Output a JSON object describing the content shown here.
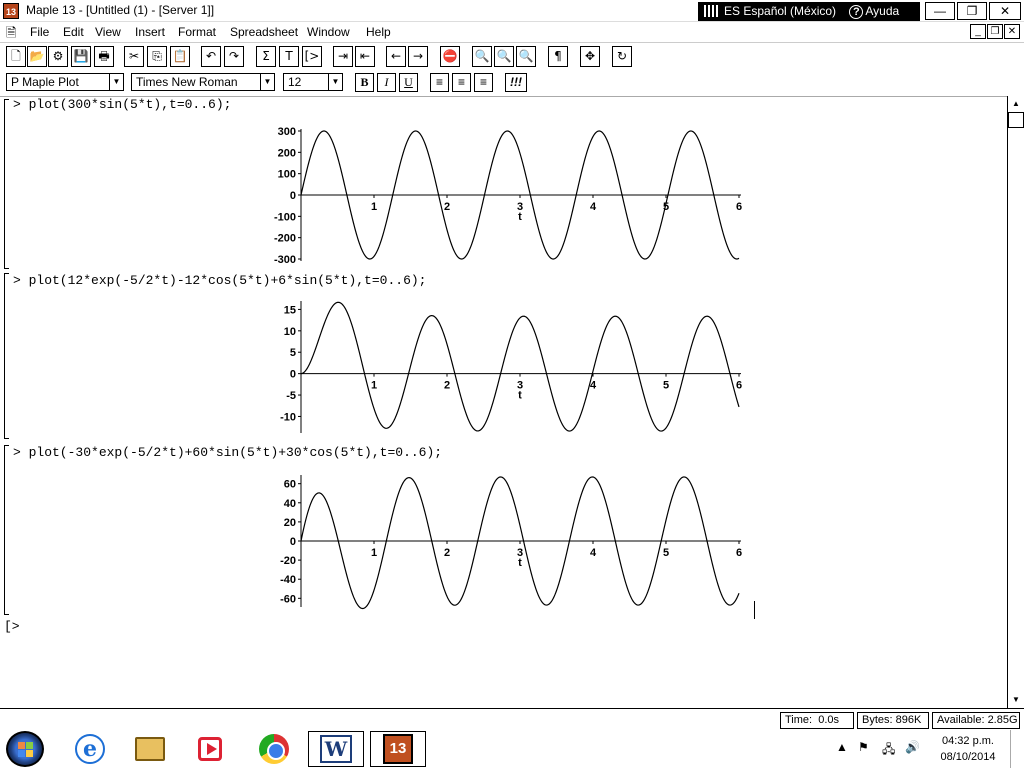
{
  "window": {
    "title": "Maple 13 - [Untitled (1) - [Server 1]]",
    "app_icon_text": "13",
    "language": "ES Español (México)",
    "help": "Ayuda",
    "help_symbol": "?",
    "minimize": "—",
    "maximize": "❐",
    "close": "✕"
  },
  "menu": {
    "items": [
      "File",
      "Edit",
      "View",
      "Insert",
      "Format",
      "Spreadsheet",
      "Window",
      "Help"
    ]
  },
  "toolbar": {
    "buttons": [
      "🗋",
      "📂",
      "⚙",
      "💾",
      "🖶",
      "✂",
      "⎘",
      "📋",
      "↶",
      "↷",
      "Σ",
      "T",
      "[>",
      "⇥",
      "⇤",
      "←",
      "→",
      "⛔",
      "🔍",
      "🔍",
      "🔍",
      "¶",
      "✥",
      "↻"
    ]
  },
  "format_bar": {
    "style_value": "P Maple Plot",
    "font_value": "Times New Roman",
    "size_value": "12",
    "bold": "B",
    "italic": "I",
    "underline": "U",
    "align_left": "≡",
    "align_center": "≡",
    "align_right": "≡",
    "excl": "!!!"
  },
  "worksheet": {
    "commands": [
      "> plot(300*sin(5*t),t=0..6);",
      "> plot(12*exp(-5/2*t)-12*cos(5*t)+6*sin(5*t),t=0..6);",
      "> plot(-30*exp(-5/2*t)+60*sin(5*t)+30*cos(5*t),t=0..6);",
      "[>"
    ]
  },
  "chart_data": [
    {
      "type": "line",
      "expression": "300*sin(5*t)",
      "xlabel": "t",
      "xlim": [
        0,
        6
      ],
      "ylim": [
        -300,
        300
      ],
      "xticks": [
        1,
        2,
        3,
        4,
        5,
        6
      ],
      "yticks": [
        300,
        200,
        100,
        0,
        -100,
        -200,
        -300
      ],
      "yticklabels": [
        "300",
        "200",
        "100",
        "0",
        "-100",
        "-200",
        "-300"
      ],
      "t": [
        0,
        0.314,
        0.628,
        0.942,
        1.257,
        1.571,
        1.885,
        2.199,
        2.513,
        2.827,
        3.142,
        3.456,
        3.77,
        4.084,
        4.398,
        4.712,
        5.027,
        5.341,
        5.655,
        6
      ],
      "y": [
        0,
        300,
        0,
        -300,
        0,
        300,
        0,
        -300,
        0,
        300,
        0,
        -300,
        0,
        300,
        0,
        -300,
        0,
        300,
        0,
        -300
      ]
    },
    {
      "type": "line",
      "expression": "12*exp(-5/2*t)-12*cos(5*t)+6*sin(5*t)",
      "xlabel": "t",
      "xlim": [
        0,
        6
      ],
      "ylim": [
        -13.4,
        16.5
      ],
      "xticks": [
        1,
        2,
        3,
        4,
        5,
        6
      ],
      "yticks": [
        15,
        10,
        5,
        0,
        -5,
        -10
      ],
      "yticklabels": [
        "15",
        "10",
        "5",
        "0",
        "-5",
        "-10"
      ],
      "peaks": [
        {
          "t": 0.48,
          "y": 16.3
        },
        {
          "t": 1.79,
          "y": 13.4
        },
        {
          "t": 3.05,
          "y": 13.4
        },
        {
          "t": 4.31,
          "y": 13.4
        },
        {
          "t": 5.56,
          "y": 13.4
        }
      ],
      "troughs": [
        {
          "t": 1.17,
          "y": -12.6
        },
        {
          "t": 2.42,
          "y": -13.4
        },
        {
          "t": 3.68,
          "y": -13.4
        },
        {
          "t": 4.93,
          "y": -13.4
        }
      ]
    },
    {
      "type": "line",
      "expression": "-30*exp(-5/2*t)+60*sin(5*t)+30*cos(5*t)",
      "xlabel": "t",
      "xlim": [
        0,
        6
      ],
      "ylim": [
        -67,
        67
      ],
      "xticks": [
        1,
        2,
        3,
        4,
        5,
        6
      ],
      "yticks": [
        60,
        40,
        20,
        0,
        -20,
        -40,
        -60
      ],
      "yticklabels": [
        "60",
        "40",
        "20",
        "0",
        "-20",
        "-40",
        "-60"
      ],
      "peaks": [
        {
          "t": 0.34,
          "y": 48
        },
        {
          "t": 1.51,
          "y": 67
        },
        {
          "t": 2.77,
          "y": 67
        },
        {
          "t": 4.02,
          "y": 67
        },
        {
          "t": 5.28,
          "y": 67
        }
      ],
      "troughs": [
        {
          "t": 0.83,
          "y": -66
        },
        {
          "t": 2.14,
          "y": -67
        },
        {
          "t": 3.4,
          "y": -67
        },
        {
          "t": 4.65,
          "y": -67
        },
        {
          "t": 5.91,
          "y": -67
        }
      ]
    }
  ],
  "status": {
    "time_label": "Time:",
    "time_value": "0.0s",
    "bytes_label": "Bytes:",
    "bytes_value": "896K",
    "available_label": "Available:",
    "available_value": "2.85G"
  },
  "taskbar": {
    "word_label": "W",
    "maple_label": "13",
    "clock_time": "04:32 p.m.",
    "clock_date": "08/10/2014"
  }
}
